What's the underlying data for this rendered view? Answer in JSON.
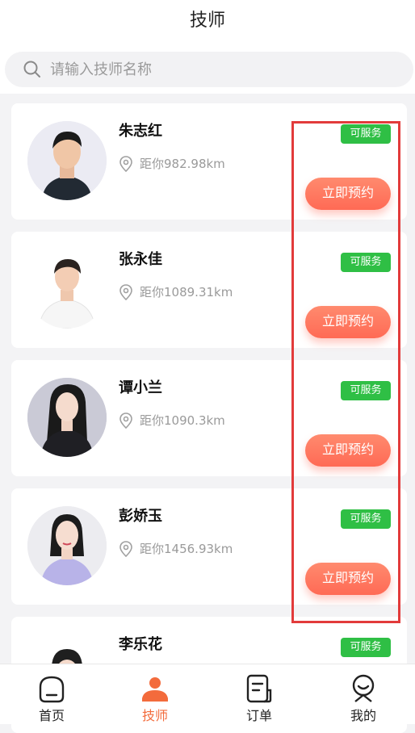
{
  "header": {
    "title": "技师"
  },
  "search": {
    "placeholder": "请输入技师名称",
    "icon": "search-icon"
  },
  "therapists": [
    {
      "name": "朱志红",
      "distance": "距你982.98km",
      "status": "可服务",
      "action": "立即预约"
    },
    {
      "name": "张永佳",
      "distance": "距你1089.31km",
      "status": "可服务",
      "action": "立即预约"
    },
    {
      "name": "谭小兰",
      "distance": "距你1090.3km",
      "status": "可服务",
      "action": "立即预约"
    },
    {
      "name": "彭娇玉",
      "distance": "距你1456.93km",
      "status": "可服务",
      "action": "立即预约"
    },
    {
      "name": "李乐花",
      "status": "可服务"
    }
  ],
  "tabbar": [
    {
      "label": "首页",
      "icon": "home-icon"
    },
    {
      "label": "技师",
      "icon": "therapist-icon",
      "active": true
    },
    {
      "label": "订单",
      "icon": "order-icon"
    },
    {
      "label": "我的",
      "icon": "profile-icon"
    }
  ],
  "colors": {
    "status_green": "#2fbf45",
    "accent_orange": "#f36b3c",
    "button_gradient_start": "#ff8a6e",
    "highlight_red": "#e23b3b"
  }
}
